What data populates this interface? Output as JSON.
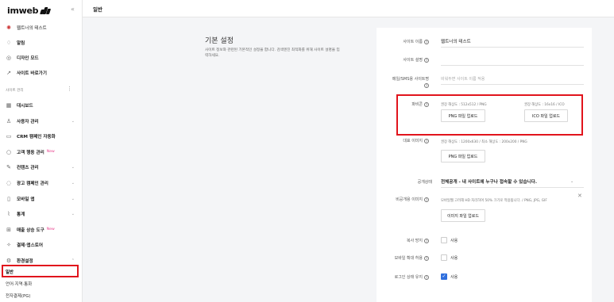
{
  "brand": {
    "name": "imweb"
  },
  "sidebar": {
    "collapse_icon": "«",
    "site_name": "웹트너의 테스트",
    "items_top": [
      {
        "icon": "bell-icon",
        "glyph": "♢",
        "label": "알림"
      },
      {
        "icon": "palette-icon",
        "glyph": "◎",
        "label": "디자인 모드"
      },
      {
        "icon": "external-link-icon",
        "glyph": "↗",
        "label": "사이트 바로가기"
      }
    ],
    "section_label": "사이트 관리",
    "menu": [
      {
        "icon": "dashboard-icon",
        "glyph": "▦",
        "label": "대시보드",
        "chevron": false,
        "badge": ""
      },
      {
        "icon": "users-icon",
        "glyph": "♙",
        "label": "사용자 관리",
        "chevron": true,
        "badge": ""
      },
      {
        "icon": "crm-icon",
        "glyph": "▭",
        "label": "CRM 캠페인 자동화",
        "chevron": false,
        "badge": ""
      },
      {
        "icon": "target-icon",
        "glyph": "○",
        "label": "고객 행동 관리",
        "chevron": false,
        "badge": "New"
      },
      {
        "icon": "edit-icon",
        "glyph": "✎",
        "label": "컨텐츠 관리",
        "chevron": true,
        "badge": ""
      },
      {
        "icon": "megaphone-icon",
        "glyph": "◌",
        "label": "광고 캠페인 관리",
        "chevron": true,
        "badge": ""
      },
      {
        "icon": "mobile-icon",
        "glyph": "▯",
        "label": "모바일 앱",
        "chevron": true,
        "badge": ""
      },
      {
        "icon": "chart-icon",
        "glyph": "⌇",
        "label": "통계",
        "chevron": true,
        "badge": ""
      },
      {
        "icon": "tools-icon",
        "glyph": "⊞",
        "label": "매출 상승 도구",
        "chevron": false,
        "badge": "New"
      },
      {
        "icon": "payment-icon",
        "glyph": "✧",
        "label": "결제·앱스토어",
        "chevron": false,
        "badge": ""
      },
      {
        "icon": "settings-icon",
        "glyph": "⚙",
        "label": "환경설정",
        "chevron": true,
        "badge": ""
      }
    ],
    "sub_items": [
      "일반",
      "언어·지역·통화",
      "전자결제(PG)"
    ]
  },
  "header": {
    "title": "일반"
  },
  "main": {
    "section_title": "기본 설정",
    "section_desc": "사이트 정보와 관련된 기본적인 설정을 합니다. 검색엔진 최적화를 위해 사이트 설명을 입력하세요.",
    "site_name_label": "사이트 이름",
    "site_name_value": "웹트너의 테스트",
    "site_desc_label": "사이트 설명",
    "email_label": "메일/SMS용 사이트명",
    "email_placeholder": "비워두면 사이트 이름 적용",
    "favicon_label": "파비콘",
    "favicon_png_hint": "권장 해상도 : 512x512 / PNG",
    "favicon_ico_hint": "권장 해상도 : 16x16 / ICO",
    "png_upload": "PNG 파일 업로드",
    "ico_upload": "ICO 파일 업로드",
    "og_label": "대표 이미지",
    "og_hint": "권장 해상도 : 1200x630 / 최소 해상도 : 200x200 / PNG",
    "og_upload": "PNG 파일 업로드",
    "public_label": "공개상태",
    "public_value": "전체공개 - 내 사이트에 누구나 접속할 수 있습니다.",
    "loading_label": "비공개용 이미지",
    "loading_hint": "모바일웹 고려해 HD 처리하여 50% 크기로 적용됩니다. / PNG, JPG, GIF",
    "image_upload": "이미지 파일 업로드",
    "copy_label": "복사 방지",
    "zoom_label": "모바일 확대 허용",
    "login_label": "로그인 상태 유지",
    "checkbox_text": "사용",
    "copy_checked": false,
    "zoom_checked": false,
    "login_checked": true
  }
}
